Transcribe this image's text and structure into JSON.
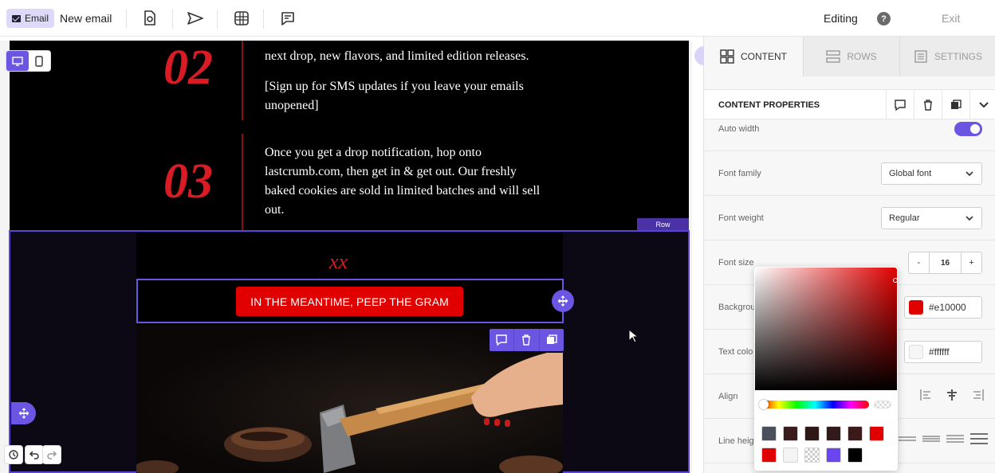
{
  "topbar": {
    "email_tag": "Email",
    "title": "New email",
    "status": "Editing",
    "help": "?",
    "exit": "Exit"
  },
  "canvas": {
    "steps": [
      {
        "number": "02",
        "lines": [
          "next drop, new flavors, and limited edition releases.",
          "[Sign up for SMS updates if you leave your emails",
          "unopened]"
        ]
      },
      {
        "number": "03",
        "lines": [
          "Once you get a drop notification, hop onto",
          "lastcrumb.com, then get in & get out. Our freshly",
          "baked cookies are sold in limited batches and will sell",
          "out."
        ]
      }
    ],
    "row_badge": "Row",
    "signoff": "xx",
    "cta_label": "IN THE MEANTIME, PEEP THE GRAM"
  },
  "panel": {
    "tabs": [
      {
        "label": "CONTENT",
        "icon": "grid-icon",
        "active": true
      },
      {
        "label": "ROWS",
        "icon": "rows-icon",
        "active": false
      },
      {
        "label": "SETTINGS",
        "icon": "settings-icon",
        "active": false
      }
    ],
    "section_title": "CONTENT PROPERTIES",
    "props": {
      "auto_width": {
        "label": "Auto width",
        "on": true
      },
      "font_family": {
        "label": "Font family",
        "value": "Global font"
      },
      "font_weight": {
        "label": "Font weight",
        "value": "Regular"
      },
      "font_size": {
        "label": "Font size",
        "value": "16",
        "minus": "-",
        "plus": "+"
      },
      "background": {
        "label": "Backgrou",
        "value": "#e10000"
      },
      "text_color": {
        "label": "Text colo",
        "value": "#ffffff"
      },
      "align": {
        "label": "Align"
      },
      "line_height": {
        "label": "Line heig"
      }
    }
  },
  "picker": {
    "current": "#e10000",
    "swatches": [
      "#4a4f5c",
      "#3a1c1c",
      "#2e1717",
      "#331a1a",
      "#3d1a1a",
      "#e10000",
      "#e10000",
      "#f4f4f4",
      "#e0e0e0",
      "#6b46f0",
      "#000000"
    ]
  },
  "colors": {
    "accent": "#6b55e3",
    "brand_red": "#e10000",
    "email_bg": "#000000"
  }
}
